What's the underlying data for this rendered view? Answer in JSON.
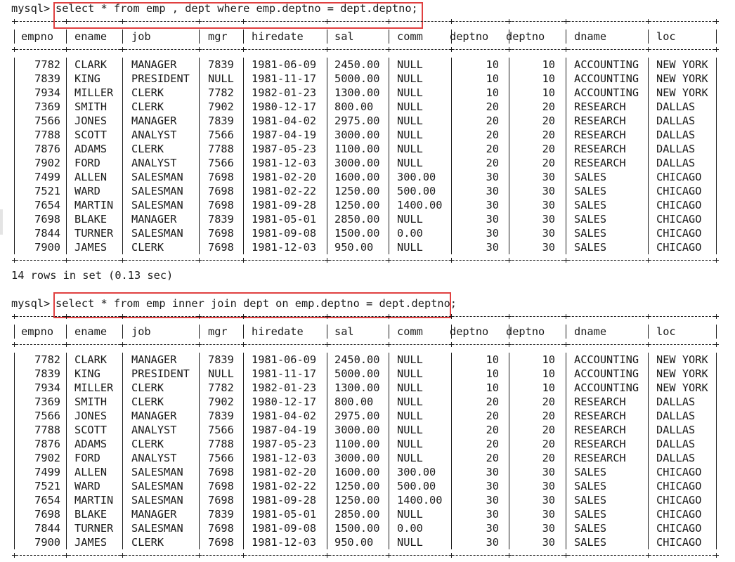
{
  "queries": [
    {
      "prompt": "mysql>",
      "sql": "select * from emp , dept where emp.deptno = dept.deptno;",
      "footer": "14 rows in set (0.13 sec)"
    },
    {
      "prompt": "mysql>",
      "sql": "select * from emp inner join dept on emp.deptno = dept.deptno;",
      "footer": ""
    }
  ],
  "columns": [
    "empno",
    "ename",
    "job",
    "mgr",
    "hiredate",
    "sal",
    "comm",
    "deptno",
    "deptno",
    "dname",
    "loc"
  ],
  "rows": [
    [
      "7782",
      "CLARK",
      "MANAGER",
      "7839",
      "1981-06-09",
      "2450.00",
      "NULL",
      "10",
      "10",
      "ACCOUNTING",
      "NEW YORK"
    ],
    [
      "7839",
      "KING",
      "PRESIDENT",
      "NULL",
      "1981-11-17",
      "5000.00",
      "NULL",
      "10",
      "10",
      "ACCOUNTING",
      "NEW YORK"
    ],
    [
      "7934",
      "MILLER",
      "CLERK",
      "7782",
      "1982-01-23",
      "1300.00",
      "NULL",
      "10",
      "10",
      "ACCOUNTING",
      "NEW YORK"
    ],
    [
      "7369",
      "SMITH",
      "CLERK",
      "7902",
      "1980-12-17",
      "800.00",
      "NULL",
      "20",
      "20",
      "RESEARCH",
      "DALLAS"
    ],
    [
      "7566",
      "JONES",
      "MANAGER",
      "7839",
      "1981-04-02",
      "2975.00",
      "NULL",
      "20",
      "20",
      "RESEARCH",
      "DALLAS"
    ],
    [
      "7788",
      "SCOTT",
      "ANALYST",
      "7566",
      "1987-04-19",
      "3000.00",
      "NULL",
      "20",
      "20",
      "RESEARCH",
      "DALLAS"
    ],
    [
      "7876",
      "ADAMS",
      "CLERK",
      "7788",
      "1987-05-23",
      "1100.00",
      "NULL",
      "20",
      "20",
      "RESEARCH",
      "DALLAS"
    ],
    [
      "7902",
      "FORD",
      "ANALYST",
      "7566",
      "1981-12-03",
      "3000.00",
      "NULL",
      "20",
      "20",
      "RESEARCH",
      "DALLAS"
    ],
    [
      "7499",
      "ALLEN",
      "SALESMAN",
      "7698",
      "1981-02-20",
      "1600.00",
      "300.00",
      "30",
      "30",
      "SALES",
      "CHICAGO"
    ],
    [
      "7521",
      "WARD",
      "SALESMAN",
      "7698",
      "1981-02-22",
      "1250.00",
      "500.00",
      "30",
      "30",
      "SALES",
      "CHICAGO"
    ],
    [
      "7654",
      "MARTIN",
      "SALESMAN",
      "7698",
      "1981-09-28",
      "1250.00",
      "1400.00",
      "30",
      "30",
      "SALES",
      "CHICAGO"
    ],
    [
      "7698",
      "BLAKE",
      "MANAGER",
      "7839",
      "1981-05-01",
      "2850.00",
      "NULL",
      "30",
      "30",
      "SALES",
      "CHICAGO"
    ],
    [
      "7844",
      "TURNER",
      "SALESMAN",
      "7698",
      "1981-09-08",
      "1500.00",
      "0.00",
      "30",
      "30",
      "SALES",
      "CHICAGO"
    ],
    [
      "7900",
      "JAMES",
      "CLERK",
      "7698",
      "1981-12-03",
      "950.00",
      "NULL",
      "30",
      "30",
      "SALES",
      "CHICAGO"
    ]
  ],
  "colors": {
    "highlight_box": "#e04040",
    "text": "#1b1b1b",
    "background": "#ffffff"
  }
}
